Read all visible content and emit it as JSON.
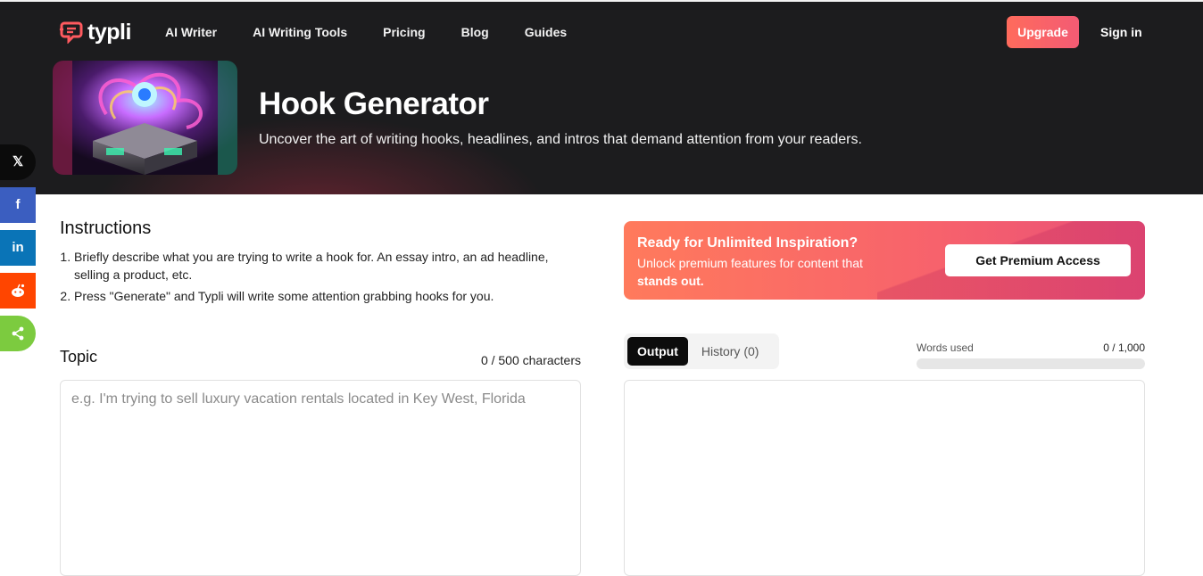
{
  "brand": {
    "name": "typli",
    "accent": "#ff5a5f"
  },
  "nav": {
    "items": [
      {
        "label": "AI Writer"
      },
      {
        "label": "AI Writing Tools"
      },
      {
        "label": "Pricing"
      },
      {
        "label": "Blog"
      },
      {
        "label": "Guides"
      }
    ],
    "upgrade_label": "Upgrade",
    "signin_label": "Sign in"
  },
  "hero": {
    "title": "Hook Generator",
    "subtitle": "Uncover the art of writing hooks, headlines, and intros that demand attention from your readers."
  },
  "share": {
    "items": [
      {
        "icon": "x-icon",
        "glyph": "𝕏"
      },
      {
        "icon": "facebook-icon",
        "glyph": "f"
      },
      {
        "icon": "linkedin-icon",
        "glyph": "in"
      },
      {
        "icon": "reddit-icon",
        "glyph": "●"
      },
      {
        "icon": "share-icon",
        "glyph": "<"
      }
    ]
  },
  "instructions": {
    "title": "Instructions",
    "steps": [
      "Briefly describe what you are trying to write a hook for. An essay intro, an ad headline, selling a product, etc.",
      "Press \"Generate\" and Typli will write some attention grabbing hooks for you."
    ]
  },
  "promo": {
    "title": "Ready for Unlimited Inspiration?",
    "text_prefix": "Unlock premium features for content that",
    "text_bold": "stands out.",
    "button_label": "Get Premium Access"
  },
  "topic": {
    "label": "Topic",
    "count": "0 / 500 characters",
    "placeholder": "e.g. I'm trying to sell luxury vacation rentals located in Key West, Florida"
  },
  "output": {
    "tabs": [
      {
        "label": "Output",
        "active": true
      },
      {
        "label": "History (0)",
        "active": false
      }
    ],
    "words_label": "Words used",
    "words_count": "0 / 1,000",
    "words_used_fraction": 0
  }
}
